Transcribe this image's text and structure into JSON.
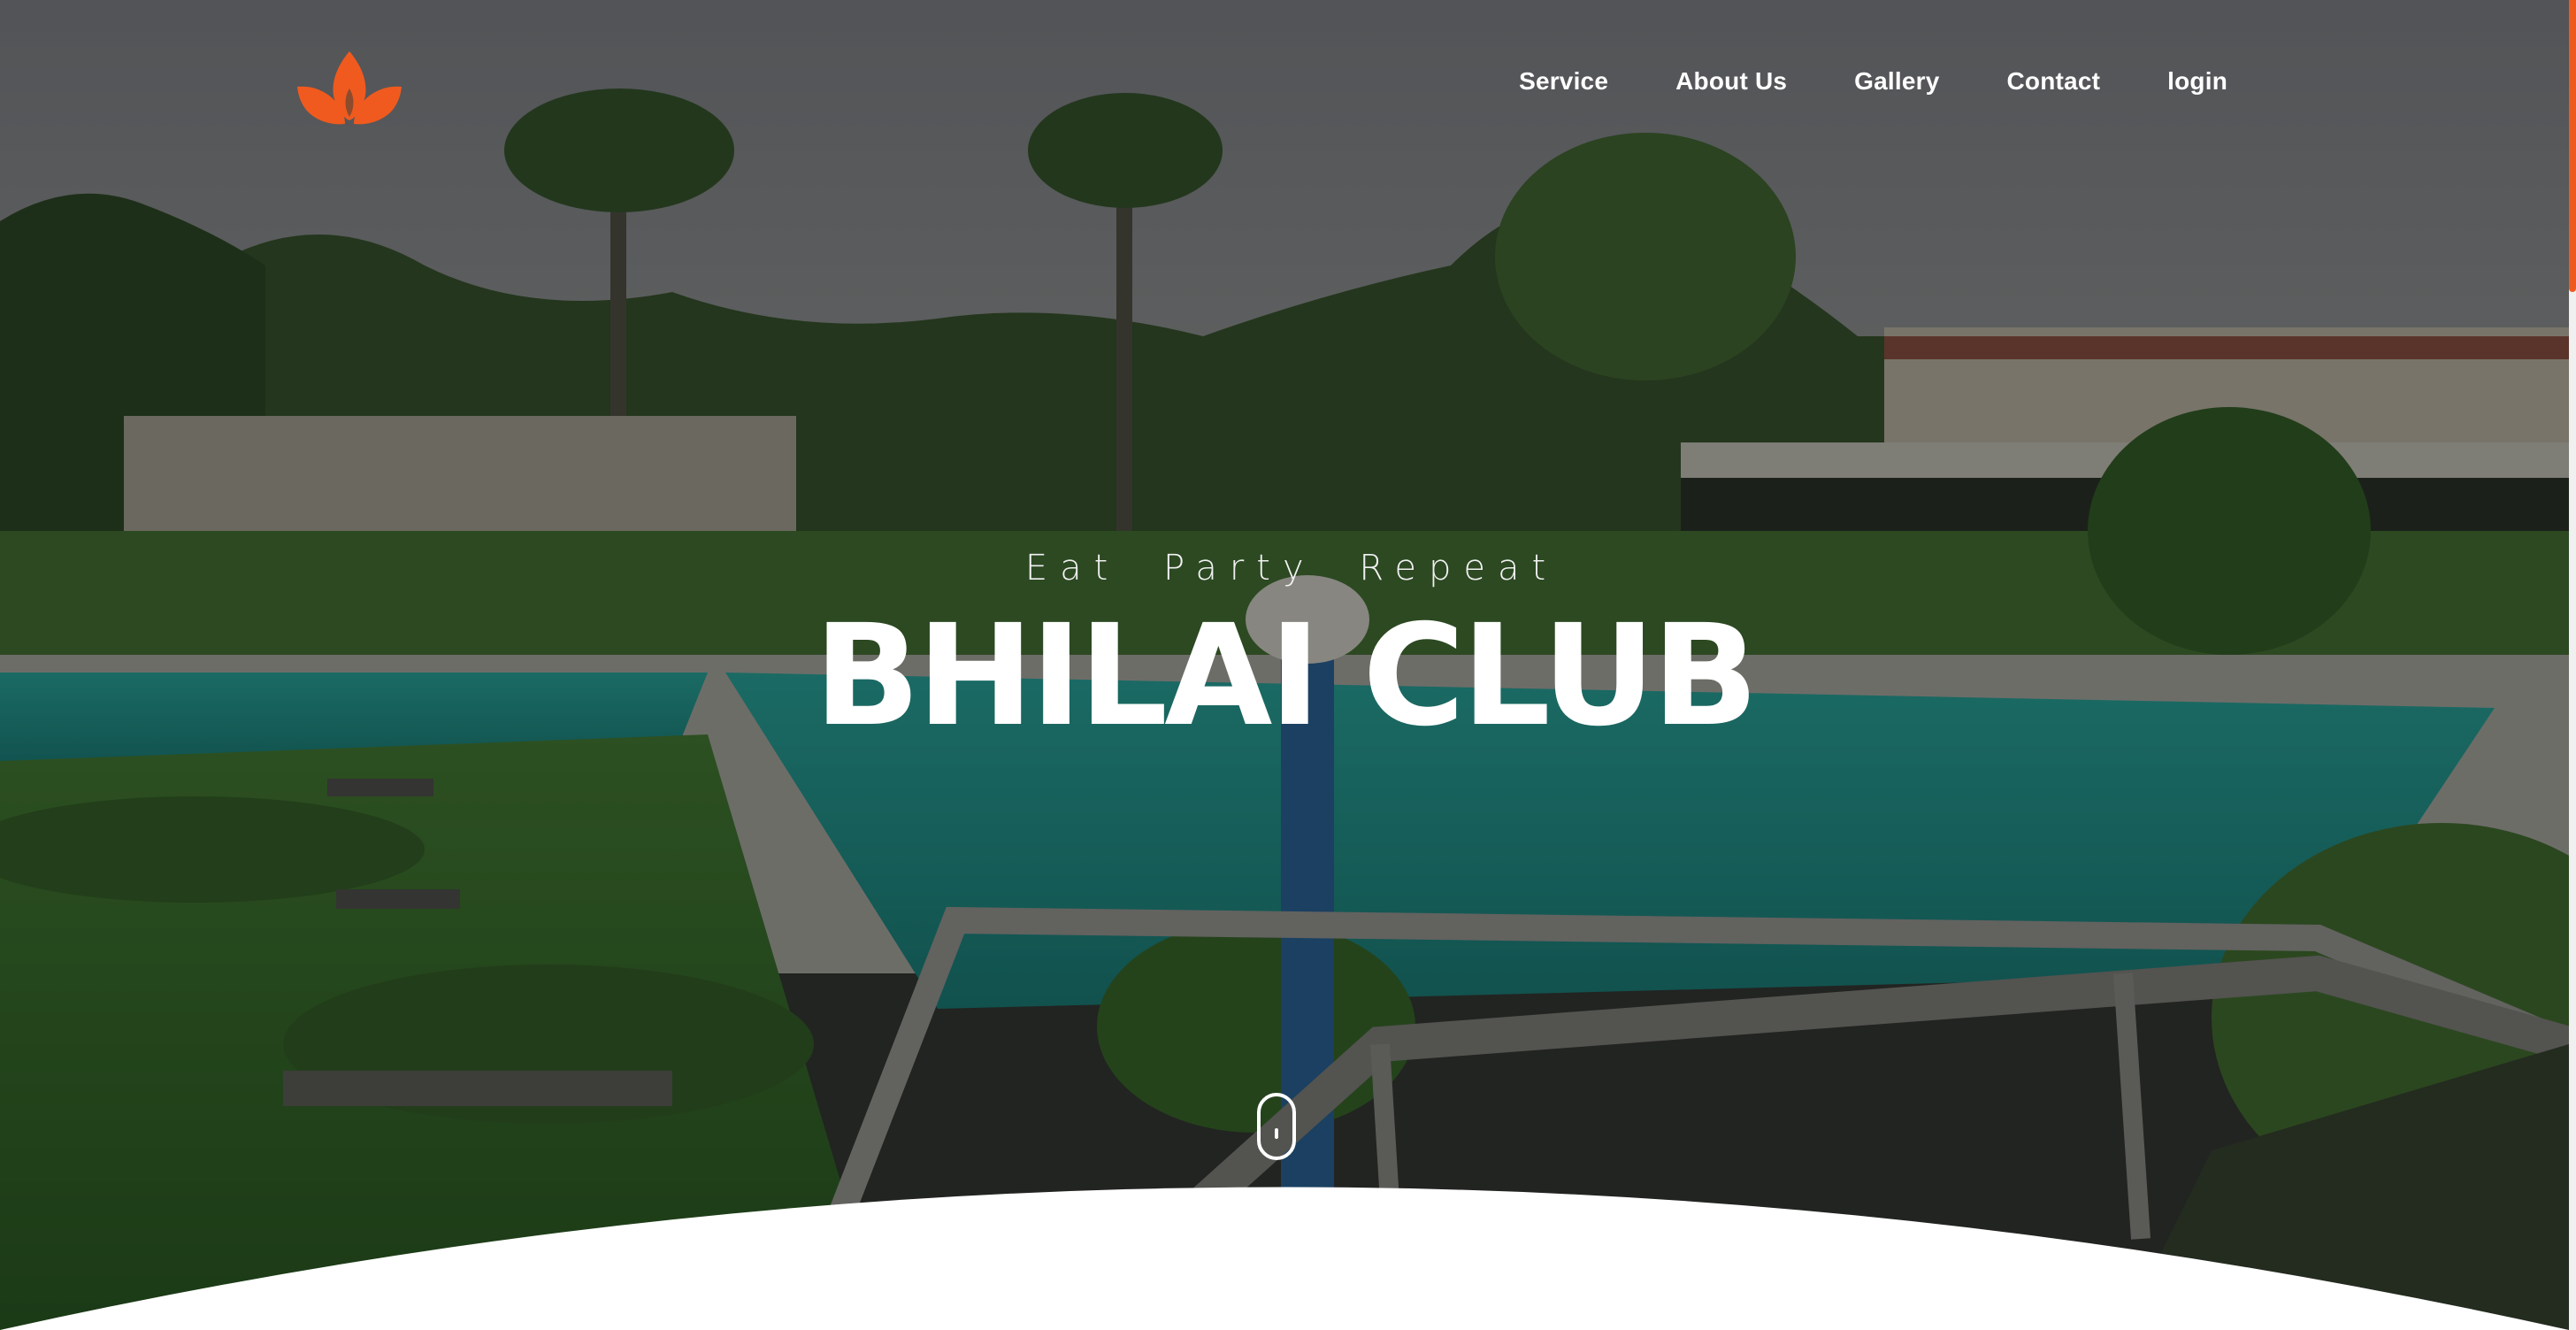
{
  "brand": {
    "logo_icon": "lotus-flame-icon",
    "logo_color": "#f05a1e"
  },
  "nav": {
    "items": [
      {
        "label": "Service"
      },
      {
        "label": "About Us"
      },
      {
        "label": "Gallery"
      },
      {
        "label": "Contact"
      },
      {
        "label": "login"
      }
    ]
  },
  "hero": {
    "tagline": "Eat Party Repeat",
    "title": "BHILAI CLUB",
    "scroll_icon": "mouse-scroll-icon"
  },
  "colors": {
    "accent": "#ee5a1d",
    "text": "#ffffff",
    "background_bottom": "#ffffff"
  }
}
